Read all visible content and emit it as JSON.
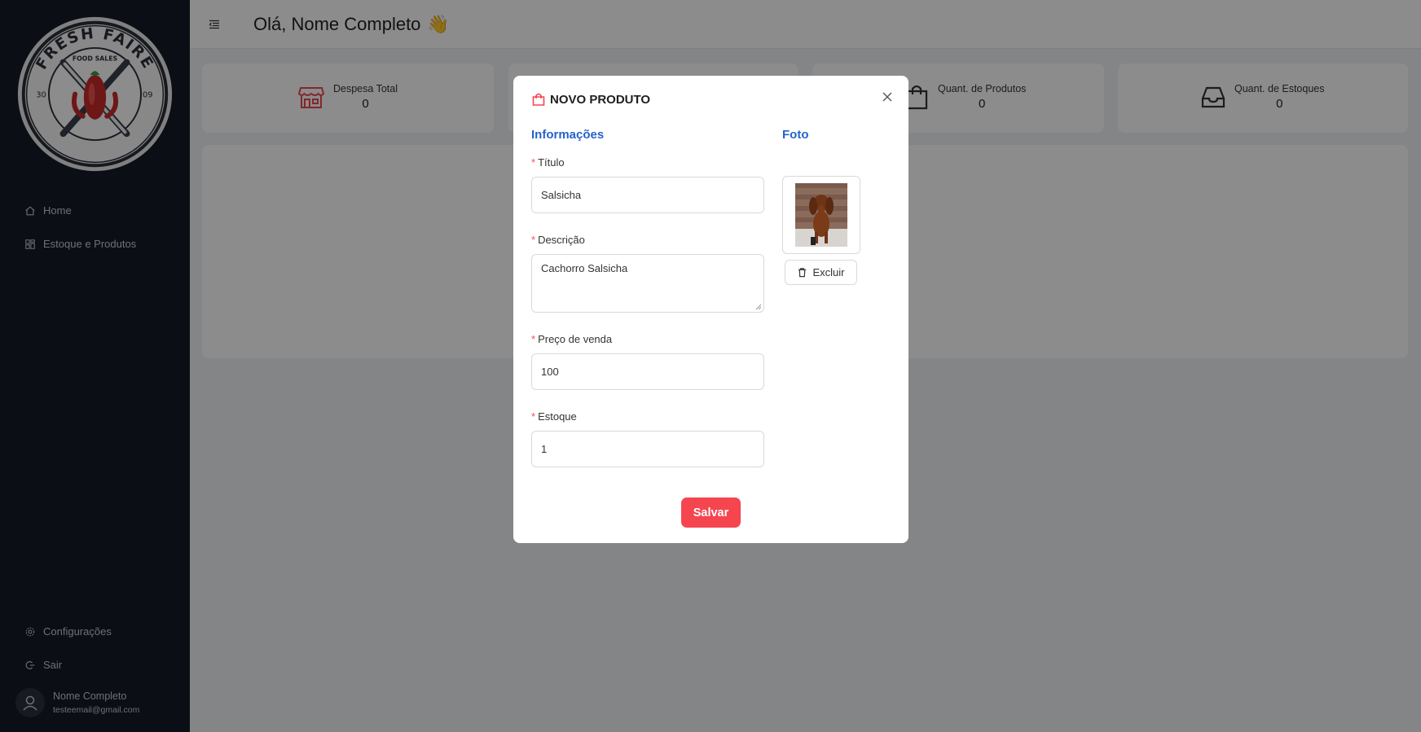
{
  "sidebar": {
    "logo": {
      "brand": "FRESH FAIRE",
      "tagline": "FOOD SALES",
      "left_num": "30",
      "right_num": "09"
    },
    "nav": [
      {
        "label": "Home",
        "icon": "home-icon"
      },
      {
        "label": "Estoque e Produtos",
        "icon": "grid-icon"
      }
    ],
    "bottom_nav": [
      {
        "label": "Configurações",
        "icon": "gear-icon"
      },
      {
        "label": "Sair",
        "icon": "logout-icon"
      }
    ],
    "user": {
      "name": "Nome Completo",
      "email": "testeemail@gmail.com"
    }
  },
  "header": {
    "greeting": "Olá, Nome Completo",
    "emoji": "👋"
  },
  "stats": [
    {
      "label": "Despesa Total",
      "value": "0",
      "icon": "store-icon",
      "icon_color": "#f5454f"
    },
    {
      "label": "Quant. de Produtos",
      "value": "0",
      "icon": "shopping-bag-icon",
      "icon_color": "#333333"
    },
    {
      "label": "Quant. de Estoques",
      "value": "0",
      "icon": "inbox-icon",
      "icon_color": "#333333"
    }
  ],
  "modal": {
    "title": "NOVO PRODUTO",
    "icon": "shopping-bag-icon",
    "info_section": "Informações",
    "photo_section": "Foto",
    "fields": {
      "titulo": {
        "label": "Título",
        "value": "Salsicha"
      },
      "descricao": {
        "label": "Descrição",
        "value": "Cachorro Salsicha"
      },
      "preco": {
        "label": "Preço de venda",
        "value": "100"
      },
      "estoque": {
        "label": "Estoque",
        "value": "1"
      }
    },
    "delete_label": "Excluir",
    "save_label": "Salvar"
  },
  "colors": {
    "sidebar": "#141a26",
    "accent": "#f5454f",
    "link": "#2563c9"
  }
}
